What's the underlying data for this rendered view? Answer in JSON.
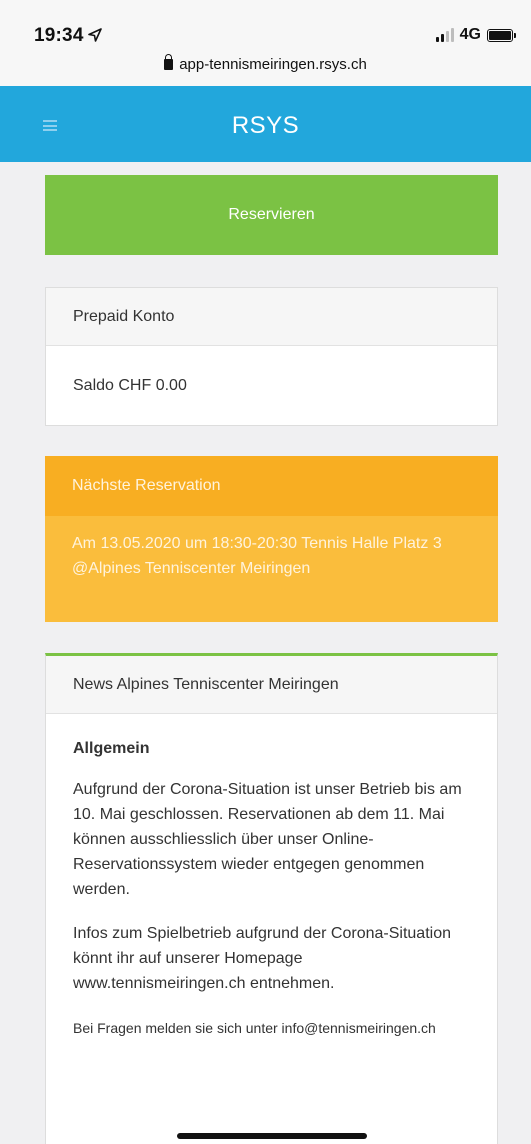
{
  "status": {
    "time": "19:34",
    "network": "4G"
  },
  "browser": {
    "url": "app-tennismeiringen.rsys.ch"
  },
  "header": {
    "brand": "RSYS"
  },
  "actions": {
    "reserve_label": "Reservieren"
  },
  "prepaid": {
    "title": "Prepaid Konto",
    "balance": "Saldo CHF 0.00"
  },
  "next_reservation": {
    "title": "Nächste Reservation",
    "text": "Am 13.05.2020 um 18:30-20:30 Tennis Halle Platz 3 @Alpines Tenniscenter Meiringen"
  },
  "news": {
    "title": "News Alpines Tenniscenter Meiringen",
    "heading": "Allgemein",
    "paragraph1": "Aufgrund der Corona-Situation ist unser Betrieb bis am 10. Mai geschlossen. Reservationen ab dem 11. Mai können ausschliesslich über unser Online-Reservationssystem wieder entgegen genommen werden.",
    "paragraph2": "Infos zum Spielbetrieb aufgrund der Corona-Situation könnt ihr auf unserer Homepage www.tennismeiringen.ch entnehmen.",
    "paragraph3": "Bei Fragen melden sie sich unter info@tennismeiringen.ch"
  },
  "colors": {
    "header": "#22a7dc",
    "reserve": "#7bc244",
    "reservation_panel": "#fabd3c"
  },
  "icons": [
    "location-arrow-icon",
    "signal-icon",
    "battery-icon",
    "lock-icon",
    "hamburger-menu-icon"
  ]
}
